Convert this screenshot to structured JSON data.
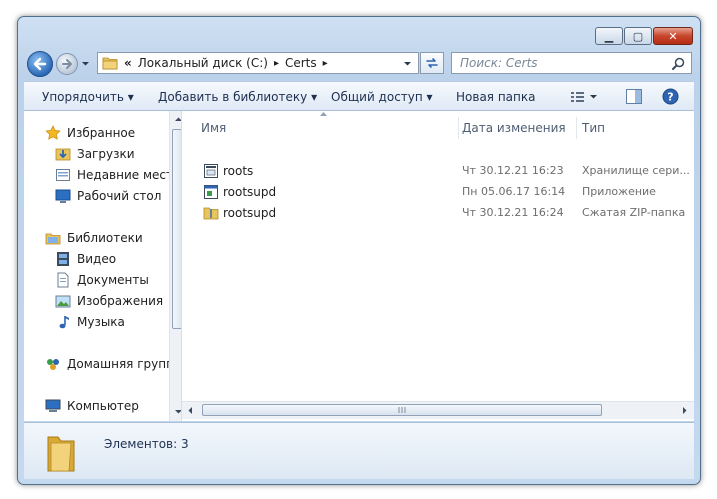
{
  "window": {
    "minimize_glyph": "▁",
    "maximize_glyph": "▢",
    "close_glyph": "✕"
  },
  "address": {
    "overflow_glyph": "«",
    "crumbs": [
      "Локальный диск (C:)",
      "Certs"
    ],
    "separator_glyph": "▸"
  },
  "search": {
    "placeholder": "Поиск: Certs"
  },
  "toolbar": {
    "organize": "Упорядочить",
    "add_to_library": "Добавить в библиотеку",
    "share": "Общий доступ",
    "new_folder": "Новая папка"
  },
  "nav": {
    "favorites": "Избранное",
    "downloads": "Загрузки",
    "recent": "Недавние места",
    "desktop": "Рабочий стол",
    "libraries": "Библиотеки",
    "video": "Видео",
    "documents": "Документы",
    "images": "Изображения",
    "music": "Музыка",
    "homegroup": "Домашняя группа",
    "computer": "Компьютер"
  },
  "columns": {
    "name": "Имя",
    "date": "Дата изменения",
    "type": "Тип"
  },
  "files": [
    {
      "name": "roots",
      "date": "Чт 30.12.21 16:23",
      "type": "Хранилище сери...",
      "icon": "certificate-store-icon"
    },
    {
      "name": "rootsupd",
      "date": "Пн 05.06.17 16:14",
      "type": "Приложение",
      "icon": "application-icon"
    },
    {
      "name": "rootsupd",
      "date": "Чт 30.12.21 16:24",
      "type": "Сжатая ZIP-папка",
      "icon": "zip-folder-icon"
    }
  ],
  "status": {
    "items_count": "Элементов: 3"
  },
  "colors": {
    "accent": "#3a75c4",
    "folder": "#e8c45c",
    "title_bg": "#c4d8ee"
  }
}
